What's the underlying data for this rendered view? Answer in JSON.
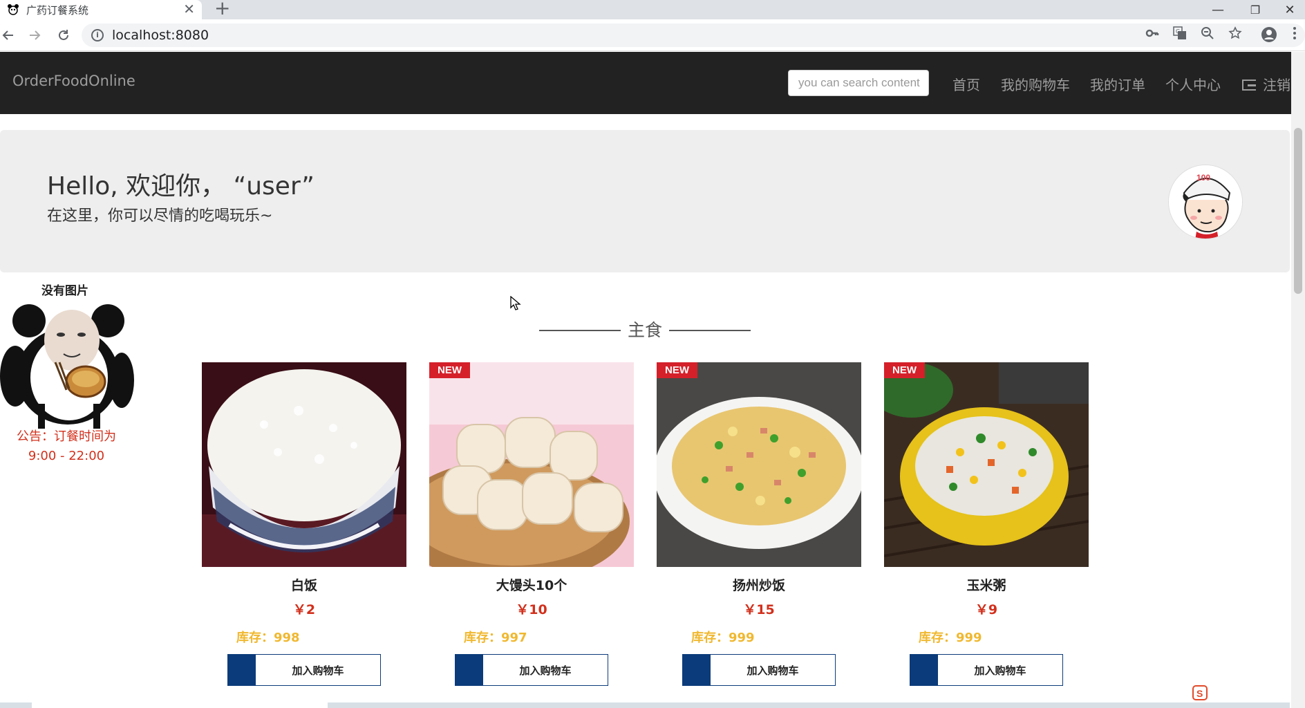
{
  "browser": {
    "tab_title": "广药订餐系统",
    "tab_close": "✕",
    "new_tab": "+",
    "url": "localhost:8080",
    "win_minimize": "—",
    "win_restore": "❐",
    "win_close": "✕"
  },
  "navbar": {
    "brand": "OrderFoodOnline",
    "search_placeholder": "you can search content",
    "links": [
      "首页",
      "我的购物车",
      "我的订单",
      "个人中心"
    ],
    "logout": "注销"
  },
  "jumbotron": {
    "title": "Hello, 欢迎你， “user”",
    "subtitle": "在这里，你可以尽情的吃喝玩乐~"
  },
  "sidebar": {
    "title": "没有图片",
    "notice_line1": "公告：订餐时间为",
    "notice_line2": "9:00 - 22:00"
  },
  "section": {
    "title": "主食"
  },
  "products": [
    {
      "name": "白饭",
      "price": "￥2",
      "stock": "库存：998",
      "badge": "",
      "button": "加入购物车"
    },
    {
      "name": "大馒头10个",
      "price": "￥10",
      "stock": "库存：997",
      "badge": "NEW",
      "button": "加入购物车"
    },
    {
      "name": "扬州炒饭",
      "price": "￥15",
      "stock": "库存：999",
      "badge": "NEW",
      "button": "加入购物车"
    },
    {
      "name": "玉米粥",
      "price": "￥9",
      "stock": "库存：999",
      "badge": "NEW",
      "button": "加入购物车"
    }
  ],
  "colors": {
    "navbar_bg": "#222222",
    "price_red": "#d2301c",
    "stock_yellow": "#f0b830",
    "button_blue": "#0b3b7a",
    "badge_red": "#d5202a"
  }
}
